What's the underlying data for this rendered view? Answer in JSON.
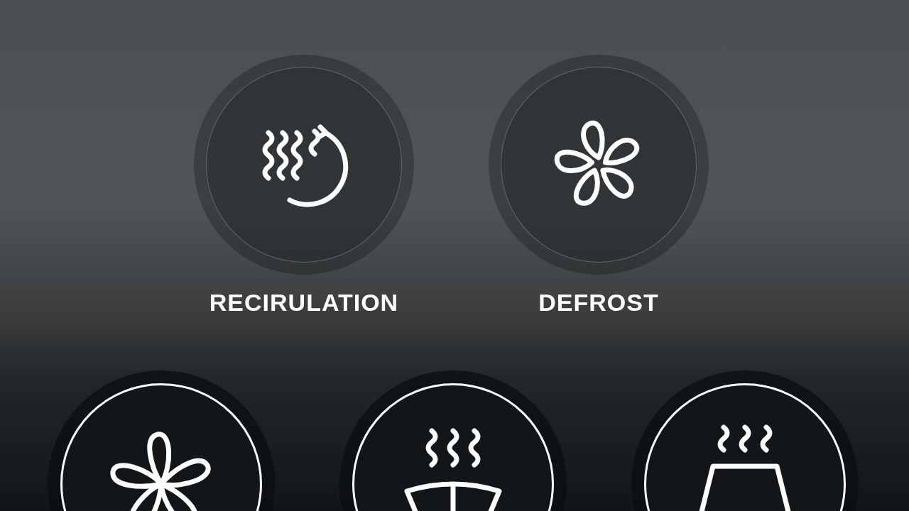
{
  "top_controls": [
    {
      "kind": "recirculation",
      "label": "RECIRULATION",
      "active": false
    },
    {
      "kind": "defrost",
      "label": "DEFROST",
      "active": false
    }
  ],
  "bottom_controls": [
    {
      "kind": "fan",
      "active": true
    },
    {
      "kind": "heat",
      "active": true
    },
    {
      "kind": "seat-heat",
      "active": true
    }
  ]
}
